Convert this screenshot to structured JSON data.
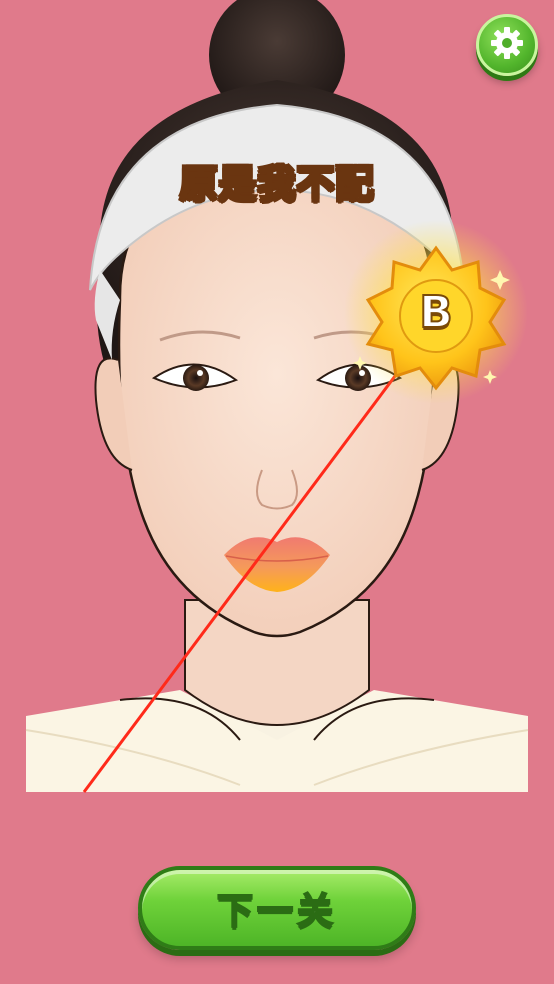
{
  "level": {
    "title": "原是我不配"
  },
  "result": {
    "grade": "B"
  },
  "buttons": {
    "next_label": "下一关"
  },
  "icons": {
    "settings": "gear-icon",
    "pointer": "arrow-icon"
  },
  "colors": {
    "background": "#e07a8b",
    "button_green": "#5cc52f",
    "badge_yellow": "#ffc21a",
    "arrow_red": "#ff2a1a"
  }
}
